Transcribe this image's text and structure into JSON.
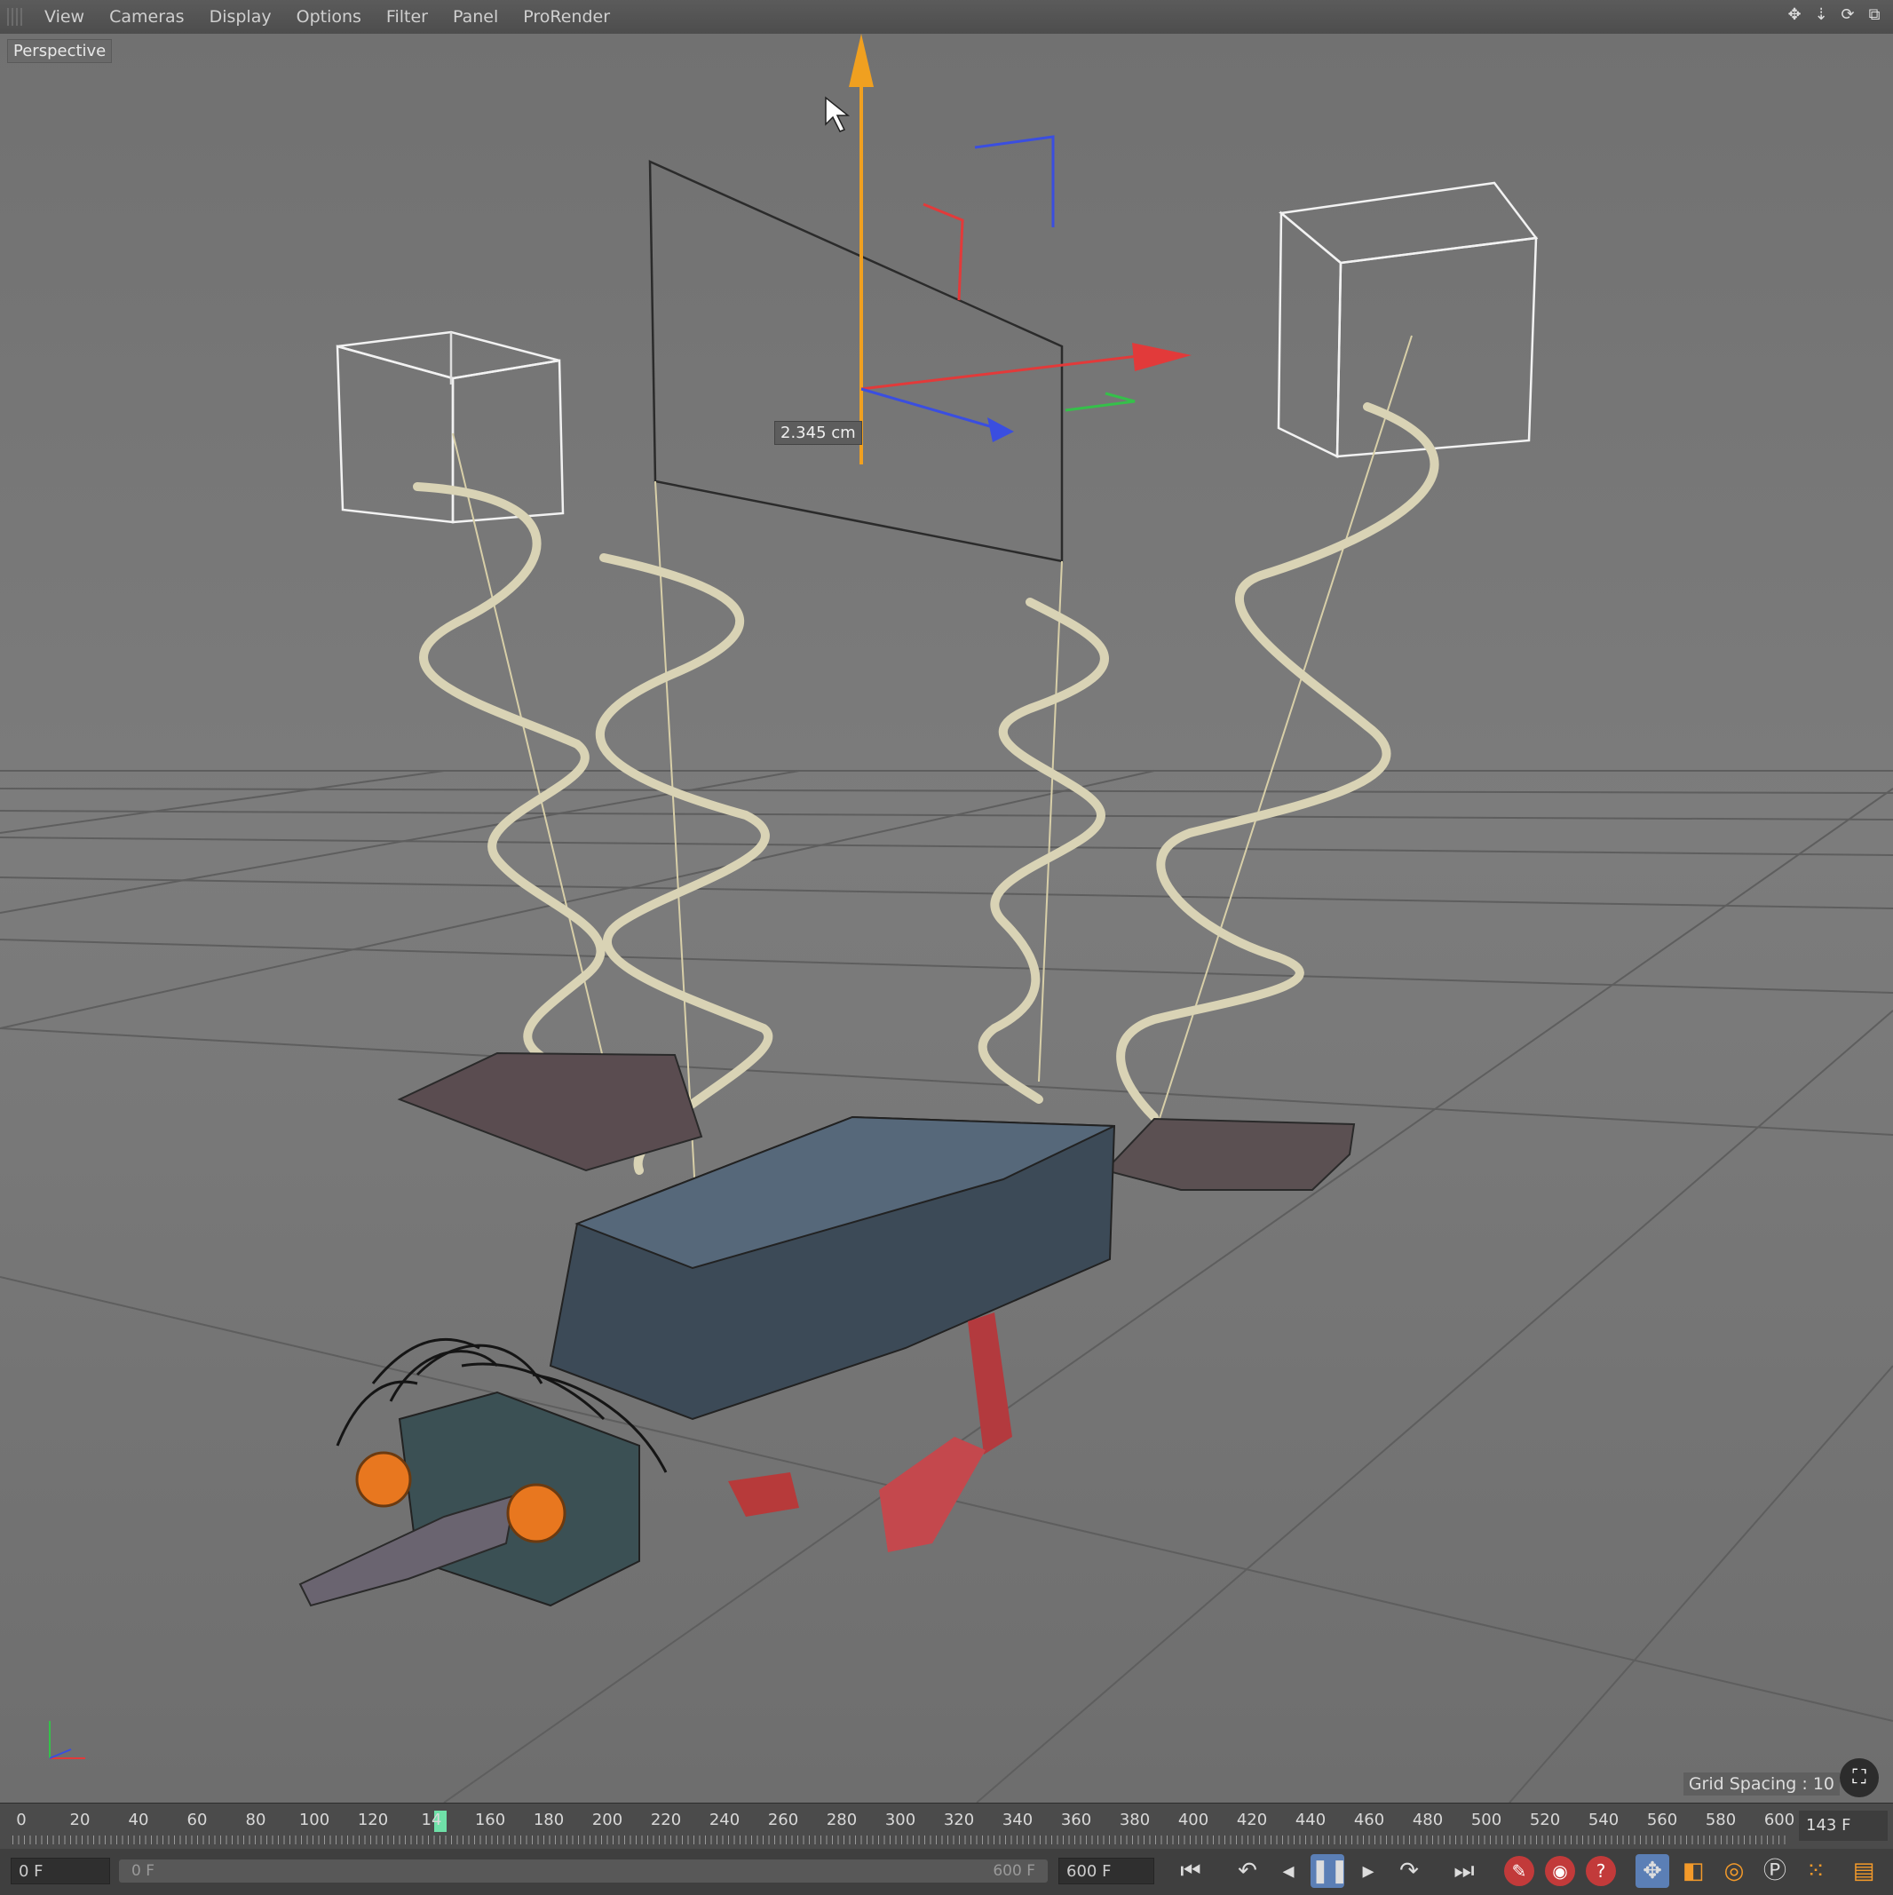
{
  "menu": {
    "items": [
      "View",
      "Cameras",
      "Display",
      "Options",
      "Filter",
      "Panel",
      "ProRender"
    ]
  },
  "window_icons": [
    "move-icon",
    "zoom-icon",
    "rotate-icon",
    "maximize-icon"
  ],
  "viewport": {
    "label": "Perspective",
    "dimension_label": "2.345 cm",
    "grid_spacing": "Grid Spacing : 10"
  },
  "timeline": {
    "ticks": [
      "0",
      "20",
      "40",
      "60",
      "80",
      "100",
      "120",
      "14",
      "160",
      "180",
      "200",
      "220",
      "240",
      "260",
      "280",
      "300",
      "320",
      "340",
      "360",
      "380",
      "400",
      "420",
      "440",
      "460",
      "480",
      "500",
      "520",
      "540",
      "560",
      "580",
      "600"
    ],
    "current_frame": "143 F",
    "playhead_frame": 143
  },
  "controls": {
    "start_frame": "0 F",
    "range_start": "0 F",
    "range_end": "600 F",
    "end_frame": "600 F"
  },
  "colors": {
    "x_axis": "#e23a3a",
    "y_axis": "#f0a020",
    "z_axis": "#3a4ee0",
    "playhead": "#6fe0a8",
    "eye": "#e8771f",
    "feet": "#c23a3a"
  }
}
